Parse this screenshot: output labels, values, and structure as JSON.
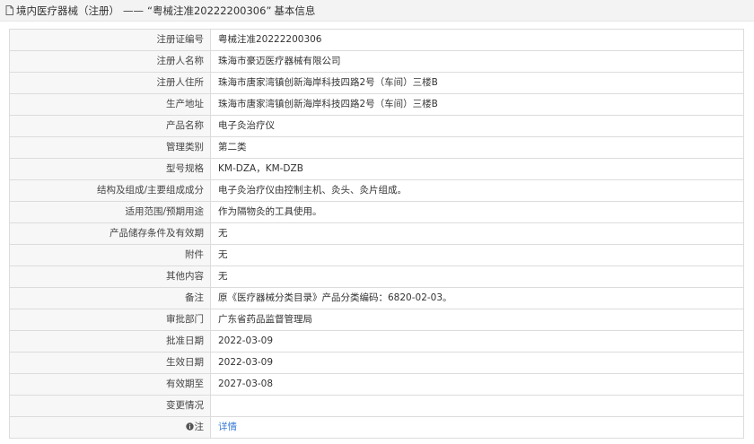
{
  "header": {
    "category": "境内医疗器械（注册）",
    "separator": "——",
    "record_title": "“粤械注准20222200306”",
    "section": "基本信息"
  },
  "rows": [
    {
      "label": "注册证编号",
      "value": "粤械注准20222200306"
    },
    {
      "label": "注册人名称",
      "value": "珠海市豪迈医疗器械有限公司"
    },
    {
      "label": "注册人住所",
      "value": "珠海市唐家湾镇创新海岸科技四路2号（车间）三楼B"
    },
    {
      "label": "生产地址",
      "value": "珠海市唐家湾镇创新海岸科技四路2号（车间）三楼B"
    },
    {
      "label": "产品名称",
      "value": "电子灸治疗仪"
    },
    {
      "label": "管理类别",
      "value": "第二类"
    },
    {
      "label": "型号规格",
      "value": "KM-DZA，KM-DZB"
    },
    {
      "label": "结构及组成/主要组成成分",
      "value": "电子灸治疗仪由控制主机、灸头、灸片组成。"
    },
    {
      "label": "适用范围/预期用途",
      "value": "作为隔物灸的工具使用。"
    },
    {
      "label": "产品储存条件及有效期",
      "value": "无"
    },
    {
      "label": "附件",
      "value": "无"
    },
    {
      "label": "其他内容",
      "value": "无"
    },
    {
      "label": "备注",
      "value": "原《医疗器械分类目录》产品分类编码：6820-02-03。"
    },
    {
      "label": "审批部门",
      "value": "广东省药品监督管理局"
    },
    {
      "label": "批准日期",
      "value": "2022-03-09"
    },
    {
      "label": "生效日期",
      "value": "2022-03-09"
    },
    {
      "label": "有效期至",
      "value": "2027-03-08"
    },
    {
      "label": "变更情况",
      "value": ""
    }
  ],
  "note_row": {
    "label": "注",
    "icon": "info-icon",
    "link_text": "详情"
  }
}
